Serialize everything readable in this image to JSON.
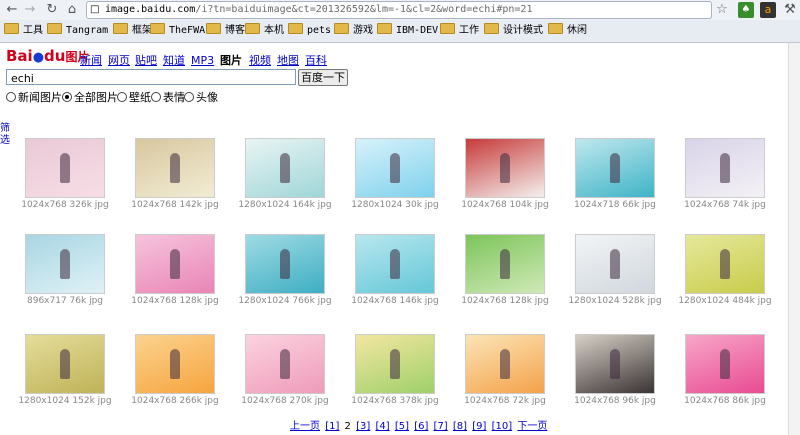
{
  "browser": {
    "back_icon": "back-arrow",
    "forward_icon": "forward-arrow",
    "reload_icon": "reload",
    "home_icon": "home",
    "url_host": "image.baidu.com",
    "url_rest": "/i?tn=baiduimage&ct=201326592&lm=-1&cl=2&word=echi#pn=21",
    "bookmarks": [
      "工具",
      "Tangram",
      "框架",
      "TheFWA",
      "博客",
      "本机",
      "pets",
      "游戏",
      "IBM-DEV",
      "工作",
      "设计模式",
      "休闲"
    ]
  },
  "header": {
    "logo_bai": "Bai",
    "logo_du": "du",
    "logo_suffix": "图片",
    "tabs": [
      "新闻",
      "网页",
      "贴吧",
      "知道",
      "MP3",
      "图片",
      "视频",
      "地图",
      "百科"
    ],
    "current_tab": "图片"
  },
  "search": {
    "value": "echi",
    "button": "百度一下"
  },
  "filters": {
    "options": [
      "新闻图片",
      "全部图片",
      "壁纸",
      "表情",
      "头像"
    ],
    "selected": "全部图片"
  },
  "side_link": "筛选",
  "grid": {
    "rows": [
      [
        "1024x768 326k jpg",
        "1024x768 142k jpg",
        "1280x1024 164k jpg",
        "1280x1024 30k jpg",
        "1024x768 104k jpg",
        "1024x718 66k jpg",
        "1024x768 74k jpg"
      ],
      [
        "896x717 76k jpg",
        "1024x768 128k jpg",
        "1280x1024 766k jpg",
        "1024x768 146k jpg",
        "1024x768 128k jpg",
        "1280x1024 528k jpg",
        "1280x1024 484k jpg"
      ],
      [
        "1280x1024 152k jpg",
        "1024x768 266k jpg",
        "1024x768 270k jpg",
        "1024x768 378k jpg",
        "1024x768 72k jpg",
        "1024x768 96k jpg",
        "1024x768 86k jpg"
      ]
    ]
  },
  "pager": {
    "prev": "上一页",
    "pages": [
      "[1]",
      "2",
      "[3]",
      "[4]",
      "[5]",
      "[6]",
      "[7]",
      "[8]",
      "[9]",
      "[10]"
    ],
    "current": "2",
    "next": "下一页"
  },
  "colors": {
    "link": "#0000cc",
    "logo_red": "#d0021b",
    "logo_blue": "#1a3bd1"
  }
}
